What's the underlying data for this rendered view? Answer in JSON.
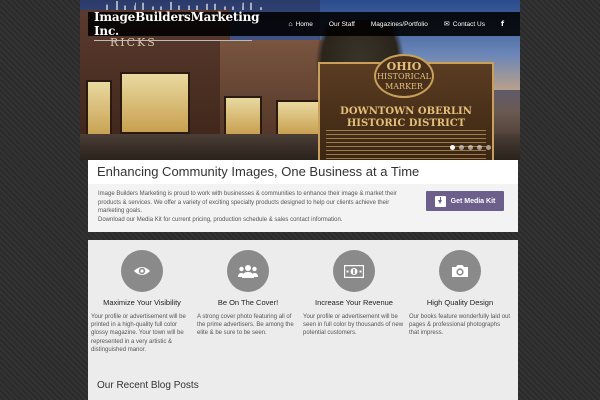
{
  "site": {
    "logo_text": "ImageBuildersMarketing Inc."
  },
  "nav": {
    "items": [
      {
        "label": "Home",
        "icon": "home-icon"
      },
      {
        "label": "Our Staff",
        "icon": ""
      },
      {
        "label": "Magazines/Portfolio",
        "icon": ""
      },
      {
        "label": "Contact Us",
        "icon": "envelope-icon"
      },
      {
        "label": "",
        "icon": "facebook-icon"
      }
    ]
  },
  "hero": {
    "storefront_sign": "RICKS",
    "marker": {
      "oval_line1": "OHIO",
      "oval_line2": "HISTORICAL",
      "oval_line3": "MARKER",
      "title_line1": "DOWNTOWN OBERLIN",
      "title_line2": "HISTORIC DISTRICT"
    },
    "slide_count": 5,
    "active_slide": 1
  },
  "intro": {
    "tagline": "Enhancing Community Images, One Business at a Time",
    "paragraph": "Image Builders Marketing is proud to work with businesses & communities to enhance their image & market their products & services. We offer a variety of exciting specialty products designed to help our clients achieve their marketing goals.",
    "download_line": "Download our Media Kit for current pricing, production schedule & sales contact information.",
    "media_kit_button": "Get Media Kit"
  },
  "features": [
    {
      "icon": "eye-icon",
      "title": "Maximize Your Visibility",
      "description": "Your profile or advertisement will be printed in a high-quality full color glossy magazine. Your town will be represented in a very artistic & distinguished manor."
    },
    {
      "icon": "group-icon",
      "title": "Be On The Cover!",
      "description": "A strong cover photo featuring all of the prime advertisers. Be among the elite & be sure to be seen."
    },
    {
      "icon": "money-icon",
      "title": "Increase Your Revenue",
      "description": "Your profile or advertisement will be seen in full color by thousands of new potential customers."
    },
    {
      "icon": "camera-icon",
      "title": "High Quality Design",
      "description": "Our books feature wonderfully laid out pages & professional photographs that impress."
    }
  ],
  "blog": {
    "heading": "Our Recent Blog Posts"
  },
  "colors": {
    "accent": "#6d5f8c",
    "feature_circle": "#8a8a8a",
    "nav_bg": "#000000"
  }
}
